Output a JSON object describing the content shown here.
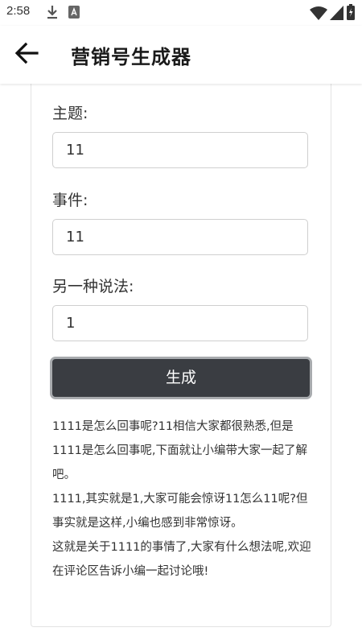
{
  "status_bar": {
    "time": "2:58",
    "icons": [
      "download-icon",
      "text-app-icon",
      "wifi-icon",
      "signal-icon",
      "battery-icon"
    ]
  },
  "app_bar": {
    "title": "营销号生成器",
    "back_icon": "arrow-left-icon"
  },
  "form": {
    "subject_label": "主题:",
    "subject_value": "11",
    "event_label": "事件:",
    "event_value": "11",
    "alt_label": "另一种说法:",
    "alt_value": "1",
    "generate_label": "生成"
  },
  "output": {
    "paragraphs": [
      "1111是怎么回事呢?11相信大家都很熟悉,但是1111是怎么回事呢,下面就让小编带大家一起了解吧。",
      "1111,其实就是1,大家可能会惊讶11怎么11呢?但事实就是这样,小编也感到非常惊讶。",
      "这就是关于1111的事情了,大家有什么想法呢,欢迎在评论区告诉小编一起讨论哦!"
    ]
  },
  "colors": {
    "button_bg": "#3a3d42",
    "button_border": "#a8abae",
    "background": "#ffffff"
  }
}
